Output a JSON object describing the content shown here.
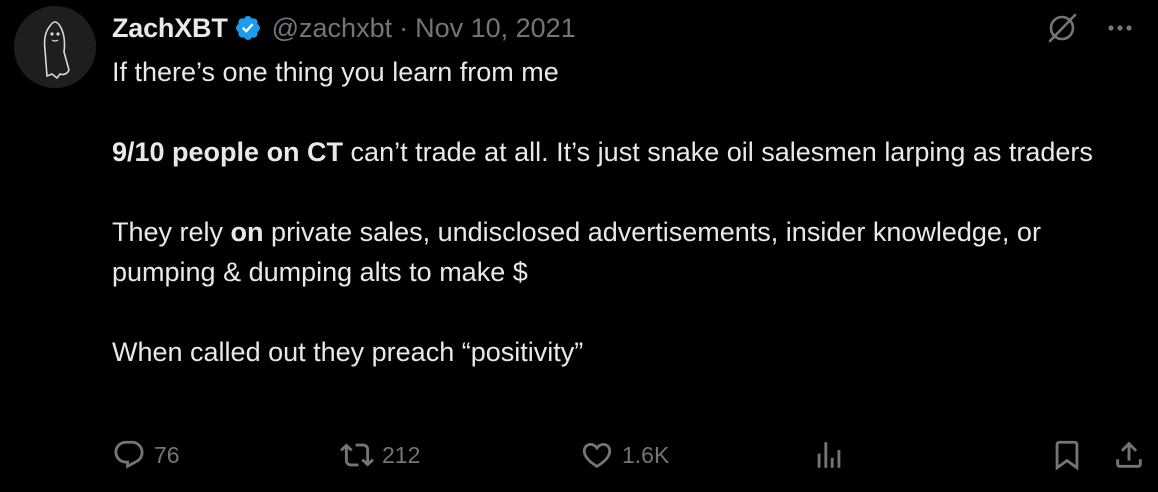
{
  "author": {
    "name": "ZachXBT",
    "handle": "@zachxbt",
    "separator": "·",
    "date": "Nov 10, 2021",
    "avatar_icon": "ghost-avatar",
    "verified_icon": "verified-badge-icon"
  },
  "tweet": {
    "line1": "If there’s one thing you learn from me",
    "p2_bold": "9/10 people on CT",
    "p2_rest": " can’t trade at all. It’s just snake oil salesmen larping as traders",
    "p3_pre": "They rely ",
    "p3_bold": "on",
    "p3_rest": " private sales, undisclosed advertisements, insider knowledge, or pumping & dumping alts to make $",
    "p4": "When called out they preach “positivity”"
  },
  "actions": {
    "replies": "76",
    "retweets": "212",
    "likes": "1.6K"
  },
  "colors": {
    "background": "#000000",
    "text": "#e7e9ea",
    "muted": "#71767b",
    "verified": "#1d9bf0"
  }
}
